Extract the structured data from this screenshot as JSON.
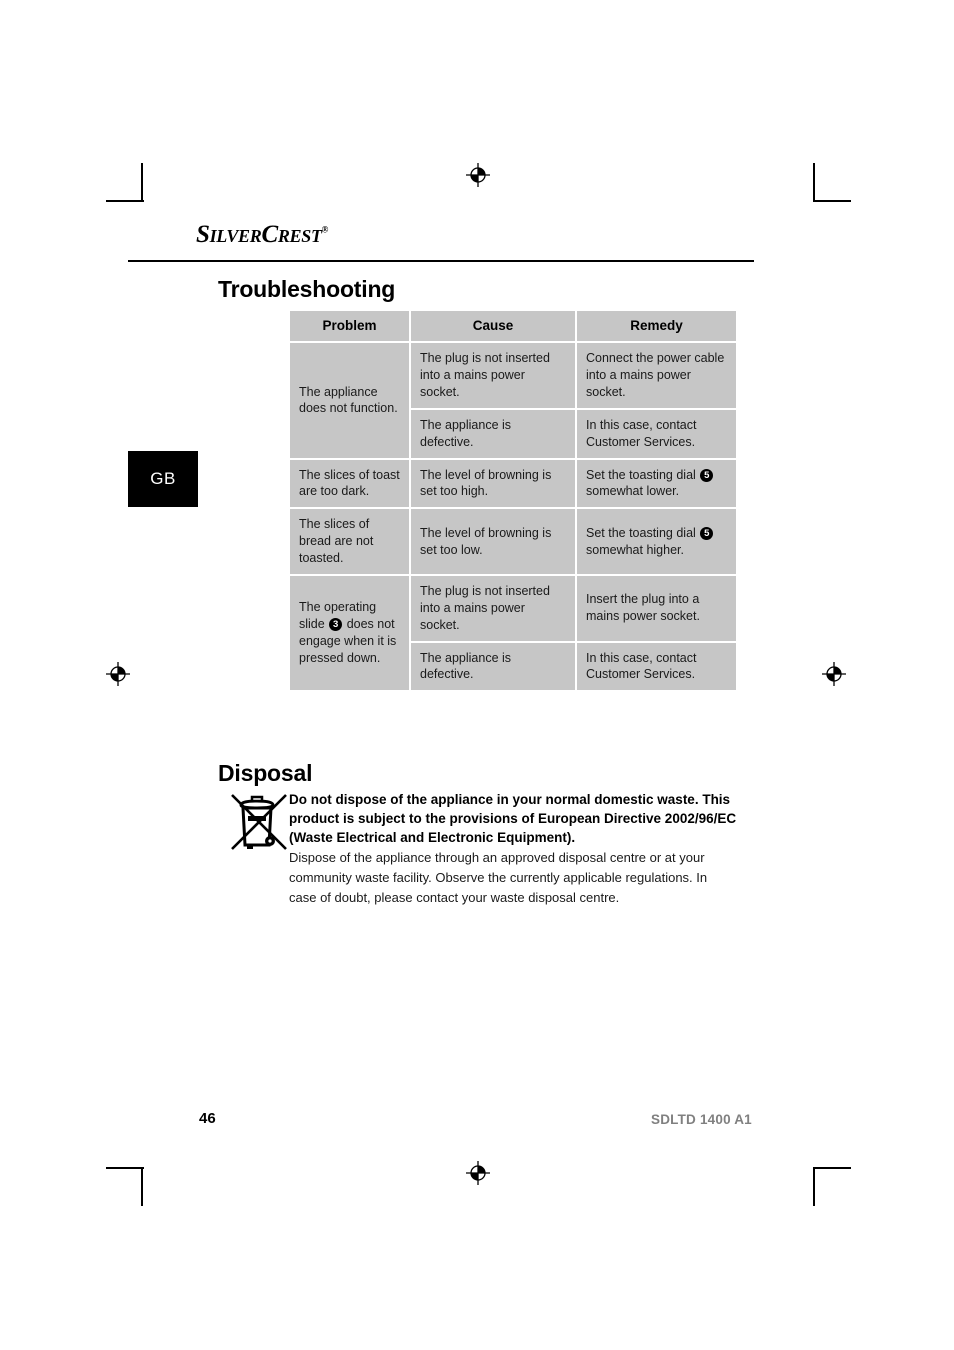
{
  "document": {
    "brand": "SilverCrest",
    "brand_trademark": "®",
    "language_tab": "GB",
    "page_number": "46",
    "model_code": "SDLTD 1400 A1"
  },
  "troubleshooting": {
    "title": "Troubleshooting",
    "columns": [
      "Problem",
      "Cause",
      "Remedy"
    ],
    "rows": [
      {
        "problem": "The appliance does not function.",
        "entries": [
          {
            "cause": "The plug is not inserted into a mains power socket.",
            "remedy": "Connect the power cable into a mains power socket."
          },
          {
            "cause": "The appliance is defective.",
            "remedy": "In this case, contact Customer Services."
          }
        ]
      },
      {
        "problem": "The slices of toast are too dark.",
        "entries": [
          {
            "cause": "The level of browning is set too high.",
            "remedy_pre": "Set the toasting dial",
            "remedy_ref": "5",
            "remedy_post": "somewhat lower."
          }
        ]
      },
      {
        "problem": "The slices of bread are not toasted.",
        "entries": [
          {
            "cause": "The level of browning is set too low.",
            "remedy_pre": "Set the toasting dial",
            "remedy_ref": "5",
            "remedy_post": "somewhat higher."
          }
        ]
      },
      {
        "problem_pre": "The operating slide",
        "problem_ref": "3",
        "problem_post": "does not engage when it is pressed down.",
        "entries": [
          {
            "cause": "The plug is not inserted into a mains power socket.",
            "remedy": "Insert the plug into a mains power socket."
          },
          {
            "cause": "The appliance is defective.",
            "remedy": "In this case, contact Customer Services."
          }
        ]
      }
    ]
  },
  "disposal": {
    "title": "Disposal",
    "icon": "crossed-out-wheelie-bin-icon",
    "bold_text": "Do not dispose of the appliance in your normal domestic waste. This product is subject to the provisions of European Directive 2002/96/EC (Waste Electrical and Electronic Equipment).",
    "body_text": "Dispose of the appliance through an approved disposal centre or at your community waste facility. Observe the currently applicable regulations. In case of doubt, please contact your waste disposal centre."
  },
  "colors": {
    "table_cell_bg": "#c6c6c6",
    "tab_bg": "#000000",
    "model_code": "#808080"
  }
}
